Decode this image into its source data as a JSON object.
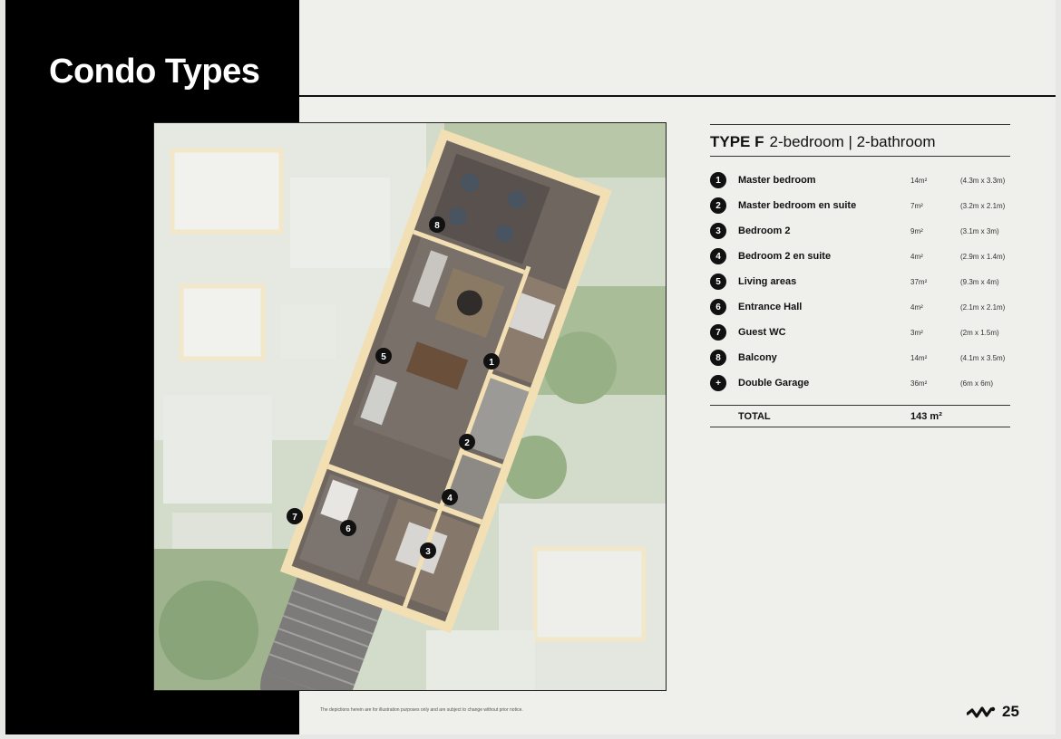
{
  "page_title": "Condo Types",
  "unit": {
    "type_label": "TYPE F",
    "description": "2-bedroom | 2-bathroom"
  },
  "rooms": [
    {
      "marker": "1",
      "name": "Master bedroom",
      "area": "14m²",
      "dims": "(4.3m x 3.3m)"
    },
    {
      "marker": "2",
      "name": "Master bedroom en suite",
      "area": "7m²",
      "dims": "(3.2m x 2.1m)"
    },
    {
      "marker": "3",
      "name": "Bedroom 2",
      "area": "9m²",
      "dims": "(3.1m x 3m)"
    },
    {
      "marker": "4",
      "name": "Bedroom 2 en suite",
      "area": "4m²",
      "dims": "(2.9m x 1.4m)"
    },
    {
      "marker": "5",
      "name": "Living areas",
      "area": "37m²",
      "dims": "(9.3m x 4m)"
    },
    {
      "marker": "6",
      "name": "Entrance Hall",
      "area": "4m²",
      "dims": "(2.1m x 2.1m)"
    },
    {
      "marker": "7",
      "name": "Guest WC",
      "area": "3m²",
      "dims": "(2m x 1.5m)"
    },
    {
      "marker": "8",
      "name": "Balcony",
      "area": "14m²",
      "dims": "(4.1m x 3.5m)"
    },
    {
      "marker": "+",
      "name": "Double Garage",
      "area": "36m²",
      "dims": "(6m x 6m)"
    }
  ],
  "total": {
    "label": "TOTAL",
    "value": "143 m²"
  },
  "disclaimer": "The depictions herein are for illustration purposes only and are subject to change without prior notice.",
  "page_number": "25",
  "colors": {
    "band": "#000000",
    "page": "#efefec",
    "wall": "#f3dfb4",
    "floor": "#6b625d"
  }
}
